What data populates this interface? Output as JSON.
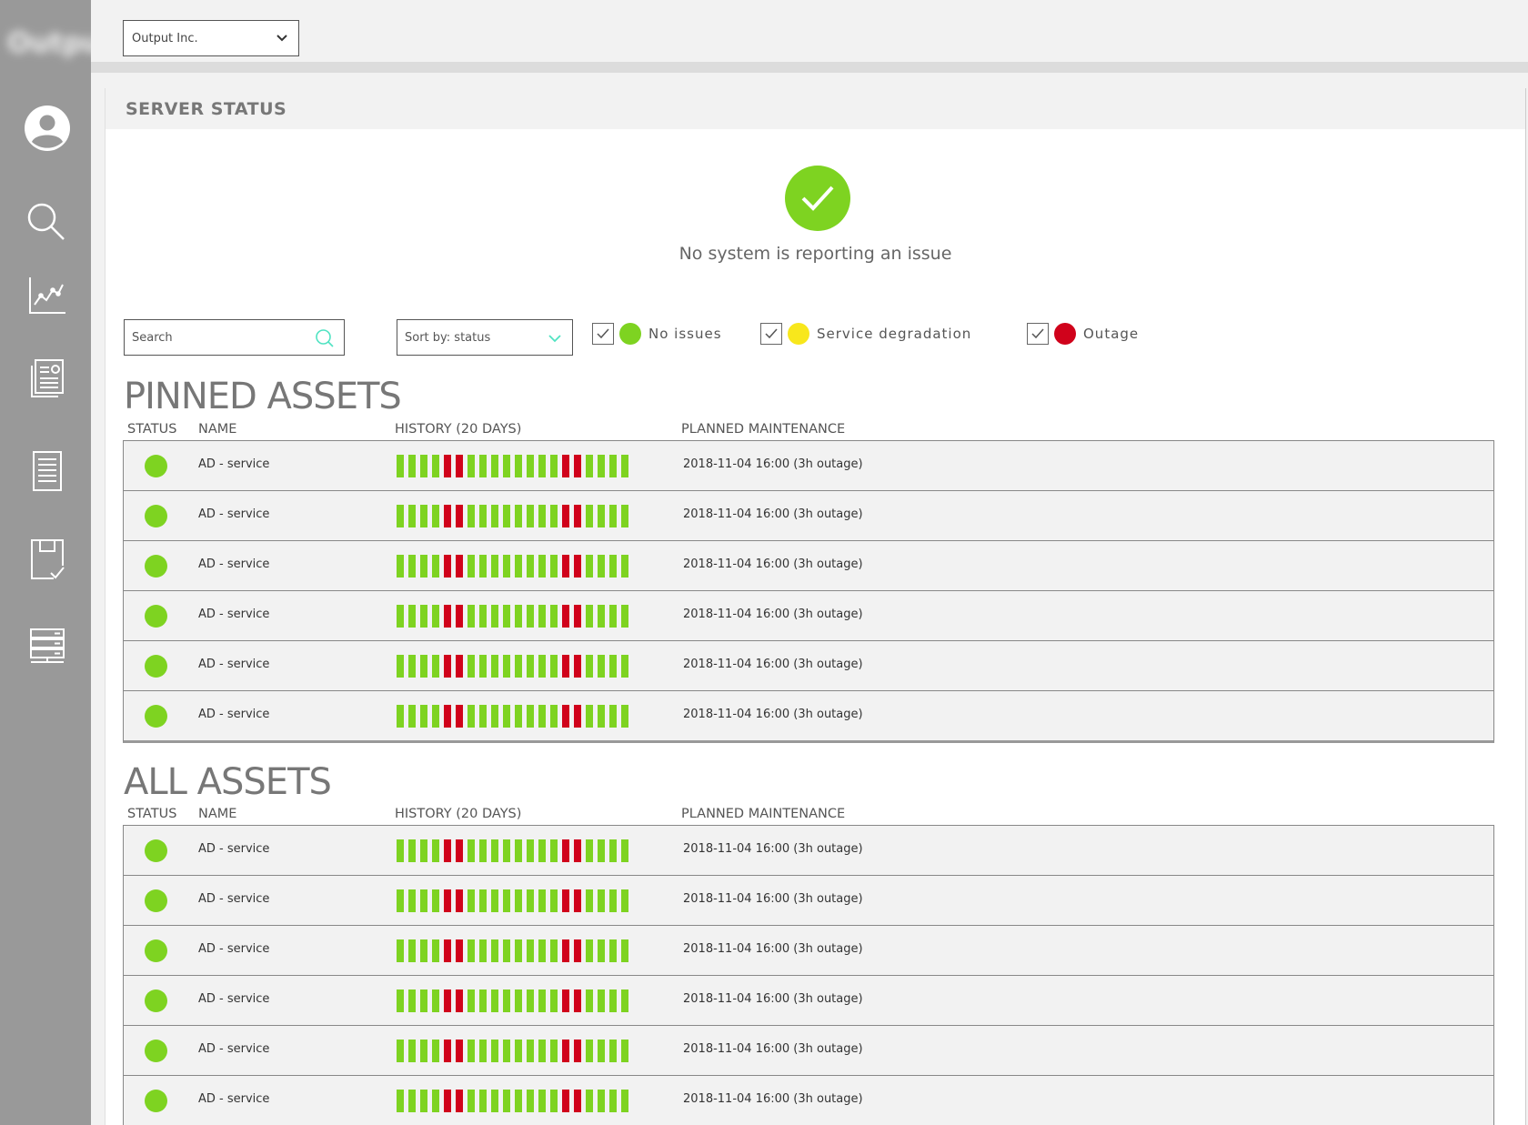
{
  "app": {
    "logo_text": "Output"
  },
  "topbar": {
    "company_select": "Output Inc."
  },
  "panel": {
    "title": "SERVER STATUS"
  },
  "hero": {
    "message": "No system is reporting an issue"
  },
  "controls": {
    "search_placeholder": "Search",
    "sort_label": "Sort by: status",
    "filters": [
      {
        "label": "No issues",
        "color": "#7ed321",
        "checked": true
      },
      {
        "label": "Service degradation",
        "color": "#f8e71c",
        "checked": true
      },
      {
        "label": "Outage",
        "color": "#d0021b",
        "checked": true
      }
    ]
  },
  "columns": {
    "status": "STATUS",
    "name": "NAME",
    "history": "HISTORY (20 DAYS)",
    "maintenance": "PLANNED MAINTENANCE"
  },
  "colors": {
    "ok": "#7ed321",
    "degraded": "#f8e71c",
    "outage": "#d0021b"
  },
  "pinned": {
    "title": "PINNED ASSETS",
    "rows": [
      {
        "status": "ok",
        "name": "AD - service",
        "history": [
          "ok",
          "ok",
          "ok",
          "ok",
          "outage",
          "outage",
          "ok",
          "ok",
          "ok",
          "ok",
          "ok",
          "ok",
          "ok",
          "ok",
          "outage",
          "outage",
          "ok",
          "ok",
          "ok",
          "ok"
        ],
        "maintenance": "2018-11-04 16:00 (3h outage)"
      },
      {
        "status": "ok",
        "name": "AD - service",
        "history": [
          "ok",
          "ok",
          "ok",
          "ok",
          "outage",
          "outage",
          "ok",
          "ok",
          "ok",
          "ok",
          "ok",
          "ok",
          "ok",
          "ok",
          "outage",
          "outage",
          "ok",
          "ok",
          "ok",
          "ok"
        ],
        "maintenance": "2018-11-04 16:00 (3h outage)"
      },
      {
        "status": "ok",
        "name": "AD - service",
        "history": [
          "ok",
          "ok",
          "ok",
          "ok",
          "outage",
          "outage",
          "ok",
          "ok",
          "ok",
          "ok",
          "ok",
          "ok",
          "ok",
          "ok",
          "outage",
          "outage",
          "ok",
          "ok",
          "ok",
          "ok"
        ],
        "maintenance": "2018-11-04 16:00 (3h outage)"
      },
      {
        "status": "ok",
        "name": "AD - service",
        "history": [
          "ok",
          "ok",
          "ok",
          "ok",
          "outage",
          "outage",
          "ok",
          "ok",
          "ok",
          "ok",
          "ok",
          "ok",
          "ok",
          "ok",
          "outage",
          "outage",
          "ok",
          "ok",
          "ok",
          "ok"
        ],
        "maintenance": "2018-11-04 16:00 (3h outage)"
      },
      {
        "status": "ok",
        "name": "AD - service",
        "history": [
          "ok",
          "ok",
          "ok",
          "ok",
          "outage",
          "outage",
          "ok",
          "ok",
          "ok",
          "ok",
          "ok",
          "ok",
          "ok",
          "ok",
          "outage",
          "outage",
          "ok",
          "ok",
          "ok",
          "ok"
        ],
        "maintenance": "2018-11-04 16:00 (3h outage)"
      },
      {
        "status": "ok",
        "name": "AD - service",
        "history": [
          "ok",
          "ok",
          "ok",
          "ok",
          "outage",
          "outage",
          "ok",
          "ok",
          "ok",
          "ok",
          "ok",
          "ok",
          "ok",
          "ok",
          "outage",
          "outage",
          "ok",
          "ok",
          "ok",
          "ok"
        ],
        "maintenance": "2018-11-04 16:00 (3h outage)"
      }
    ]
  },
  "all": {
    "title": "ALL ASSETS",
    "rows": [
      {
        "status": "ok",
        "name": "AD - service",
        "history": [
          "ok",
          "ok",
          "ok",
          "ok",
          "outage",
          "outage",
          "ok",
          "ok",
          "ok",
          "ok",
          "ok",
          "ok",
          "ok",
          "ok",
          "outage",
          "outage",
          "ok",
          "ok",
          "ok",
          "ok"
        ],
        "maintenance": "2018-11-04 16:00 (3h outage)"
      },
      {
        "status": "ok",
        "name": "AD - service",
        "history": [
          "ok",
          "ok",
          "ok",
          "ok",
          "outage",
          "outage",
          "ok",
          "ok",
          "ok",
          "ok",
          "ok",
          "ok",
          "ok",
          "ok",
          "outage",
          "outage",
          "ok",
          "ok",
          "ok",
          "ok"
        ],
        "maintenance": "2018-11-04 16:00 (3h outage)"
      },
      {
        "status": "ok",
        "name": "AD - service",
        "history": [
          "ok",
          "ok",
          "ok",
          "ok",
          "outage",
          "outage",
          "ok",
          "ok",
          "ok",
          "ok",
          "ok",
          "ok",
          "ok",
          "ok",
          "outage",
          "outage",
          "ok",
          "ok",
          "ok",
          "ok"
        ],
        "maintenance": "2018-11-04 16:00 (3h outage)"
      },
      {
        "status": "ok",
        "name": "AD - service",
        "history": [
          "ok",
          "ok",
          "ok",
          "ok",
          "outage",
          "outage",
          "ok",
          "ok",
          "ok",
          "ok",
          "ok",
          "ok",
          "ok",
          "ok",
          "outage",
          "outage",
          "ok",
          "ok",
          "ok",
          "ok"
        ],
        "maintenance": "2018-11-04 16:00 (3h outage)"
      },
      {
        "status": "ok",
        "name": "AD - service",
        "history": [
          "ok",
          "ok",
          "ok",
          "ok",
          "outage",
          "outage",
          "ok",
          "ok",
          "ok",
          "ok",
          "ok",
          "ok",
          "ok",
          "ok",
          "outage",
          "outage",
          "ok",
          "ok",
          "ok",
          "ok"
        ],
        "maintenance": "2018-11-04 16:00 (3h outage)"
      },
      {
        "status": "ok",
        "name": "AD - service",
        "history": [
          "ok",
          "ok",
          "ok",
          "ok",
          "outage",
          "outage",
          "ok",
          "ok",
          "ok",
          "ok",
          "ok",
          "ok",
          "ok",
          "ok",
          "outage",
          "outage",
          "ok",
          "ok",
          "ok",
          "ok"
        ],
        "maintenance": "2018-11-04 16:00 (3h outage)"
      }
    ]
  },
  "nav": [
    {
      "icon": "user-icon"
    },
    {
      "icon": "search-icon"
    },
    {
      "icon": "chart-icon"
    },
    {
      "icon": "reports-icon"
    },
    {
      "icon": "document-icon"
    },
    {
      "icon": "clipboard-check-icon"
    },
    {
      "icon": "server-icon"
    }
  ]
}
